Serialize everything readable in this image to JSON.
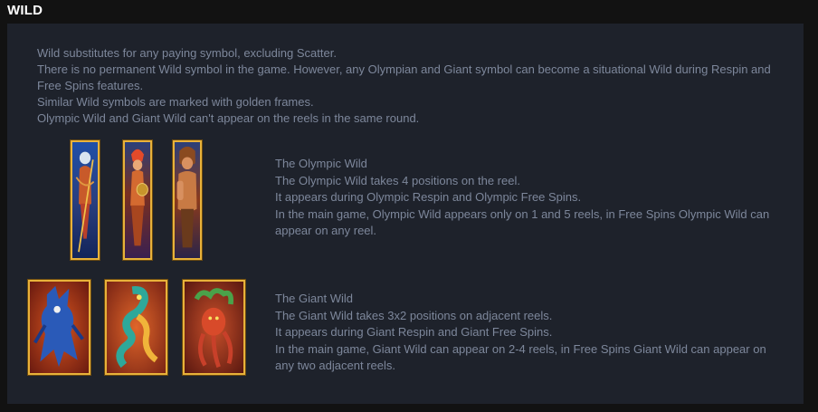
{
  "header": {
    "title": "WILD"
  },
  "intro": {
    "lines": [
      "Wild substitutes for any paying symbol, excluding Scatter.",
      "There is no permanent Wild symbol in the game. However, any Olympian and Giant symbol can become a situational Wild during Respin and Free Spins features.",
      "Similar Wild symbols are marked with golden frames.",
      "Olympic Wild and Giant Wild can't appear on the reels in the same round."
    ]
  },
  "olympic": {
    "lines": [
      "The Olympic Wild",
      "The Olympic Wild takes 4 positions on the reel.",
      "It appears during Olympic Respin and Olympic Free Spins.",
      "In the main game, Olympic Wild appears only on 1 and 5 reels, in Free Spins Olympic Wild can appear on any reel."
    ],
    "symbols": [
      "poseidon-wild-icon",
      "amazon-warrior-wild-icon",
      "hercules-wild-icon"
    ]
  },
  "giant": {
    "lines": [
      "The Giant Wild",
      "The Giant Wild takes 3x2 positions on adjacent reels.",
      "It appears during Giant Respin and Giant Free Spins.",
      "In the main game, Giant Wild can appear on 2-4 reels, in Free Spins Giant Wild can appear on any two adjacent reels."
    ],
    "symbols": [
      "blue-giant-wild-icon",
      "serpent-giant-wild-icon",
      "tentacle-giant-wild-icon"
    ]
  },
  "colors": {
    "page_bg": "#121212",
    "panel_bg": "#1e222b",
    "text": "#7d879b",
    "gold_frame": "#e8b23a"
  }
}
